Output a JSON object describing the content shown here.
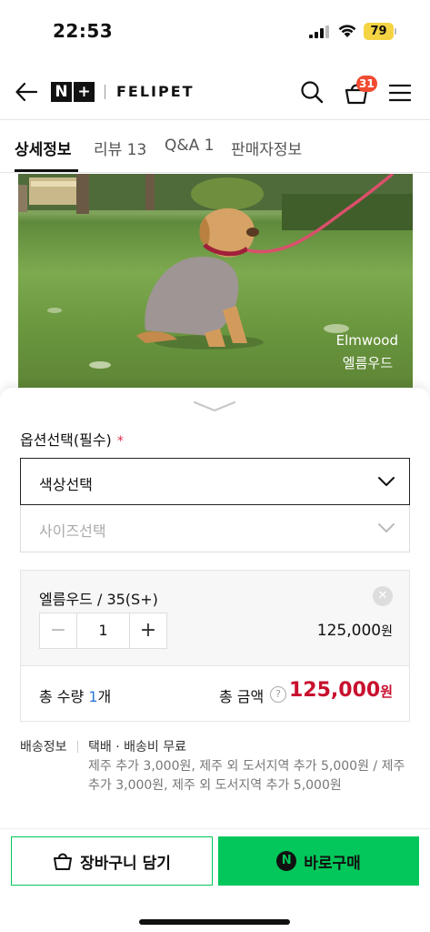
{
  "status": {
    "time": "22:53",
    "battery": "79"
  },
  "header": {
    "logo_n": "N",
    "logo_plus": "+",
    "brand": "FELIPET",
    "cart_count": "31"
  },
  "tabs": [
    {
      "label": "상세정보"
    },
    {
      "label": "리뷰 13"
    },
    {
      "label": "Q&A 1"
    },
    {
      "label": "판매자정보"
    }
  ],
  "photo": {
    "caption_en": "Elmwood",
    "caption_ko": "엘름우드"
  },
  "options": {
    "label": "옵션선택(필수)",
    "required_mark": "*",
    "color_select": "색상선택",
    "size_select": "사이즈선택"
  },
  "selected_item": {
    "name": "엘름우드 / 35(S+)",
    "remove": "✕",
    "minus": "−",
    "quantity": "1",
    "plus": "+",
    "price": "125,000",
    "currency": "원"
  },
  "total": {
    "qty_label": "총 수량 ",
    "qty_value": "1",
    "qty_unit": "개",
    "amount_label": "총 금액",
    "help": "?",
    "amount": "125,000",
    "currency": "원"
  },
  "shipping": {
    "label": "배송정보",
    "main": "택배 · 배송비 무료",
    "extra": "제주 추가 3,000원, 제주 외 도서지역 추가 5,000원 / 제주 추가 3,000원, 제주 외 도서지역 추가 5,000원"
  },
  "actions": {
    "cart": "장바구니 담기",
    "buy": "바로구매",
    "buy_logo": "N"
  },
  "colors": {
    "naver_green": "#03c75a",
    "price_red": "#c8102e",
    "badge_red": "#f04b31"
  }
}
